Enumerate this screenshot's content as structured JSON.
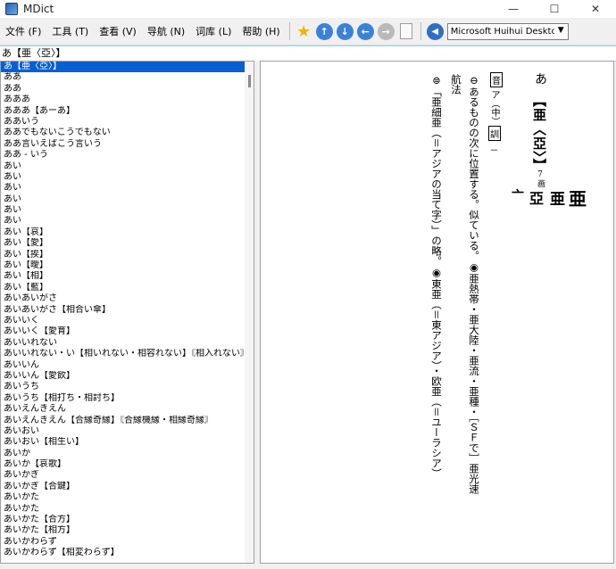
{
  "window": {
    "title": "MDict",
    "controls": {
      "minimize": "—",
      "maximize": "☐",
      "close": "✕"
    }
  },
  "menu": [
    "文件 (F)",
    "工具 (T)",
    "查看 (V)",
    "导航 (N)",
    "词库 (L)",
    "帮助 (H)"
  ],
  "toolbar": {
    "icons": [
      "star-icon",
      "up-arrow-icon",
      "down-arrow-icon",
      "back-arrow-icon",
      "forward-arrow-icon",
      "document-icon",
      "speaker-icon"
    ],
    "voice": "Microsoft Huihui Desktop - C"
  },
  "search": {
    "value": "あ【亜〈亞〉】"
  },
  "word_list": [
    "あ【亜〈亞〉】",
    "ああ",
    "ああ",
    "あああ",
    "あああ【あーあ】",
    "ああいう",
    "ああでもないこうでもない",
    "ああ言いえばこう言いう",
    "ああ - いう",
    "あい",
    "あい",
    "あい",
    "あい",
    "あい",
    "あい",
    "あい【哀】",
    "あい【愛】",
    "あい【挨】",
    "あい【曖】",
    "あい【相】",
    "あい【藍】",
    "あいあいがさ",
    "あいあいがさ【相合い傘】",
    "あいいく",
    "あいいく【愛育】",
    "あいいれない",
    "あいいれない・い【相いれない・相容れない】〘相入れない〙",
    "あいいん",
    "あいいん【愛飲】",
    "あいうち",
    "あいうち【相打ち・相討ち】",
    "あいえんきえん",
    "あいえんきえん【合縁奇縁】〘合縁機縁・相縁奇縁〙",
    "あいおい",
    "あいおい【相生い】",
    "あいか",
    "あいか【哀歌】",
    "あいかぎ",
    "あいかぎ【合鍵】",
    "あいかた",
    "あいかた",
    "あいかた【合方】",
    "あいかた【相方】",
    "あいかわらず",
    "あいかわらず【相変わらず】"
  ],
  "entry": {
    "kana": "あ",
    "headword": "【亜〈亞〉】",
    "strokes": "7画",
    "kanji_forms": [
      "亜",
      "亜",
      "亞",
      "亠"
    ],
    "on_label": "音",
    "on_reading": "ア（中）",
    "kun_label": "訓",
    "kun_reading": "－",
    "sense1": "⊖あるものの次に位置する。似ている。◉亜熱帯・亜大陸・亜流・亜種・［ＳＦで］亜光速",
    "sense1b": "航法",
    "sense2": "⊜「亜細亜（＝アジアの当て字）」の略。◉東亜（＝東アジア）・欧亜（＝ユーラシア）"
  }
}
